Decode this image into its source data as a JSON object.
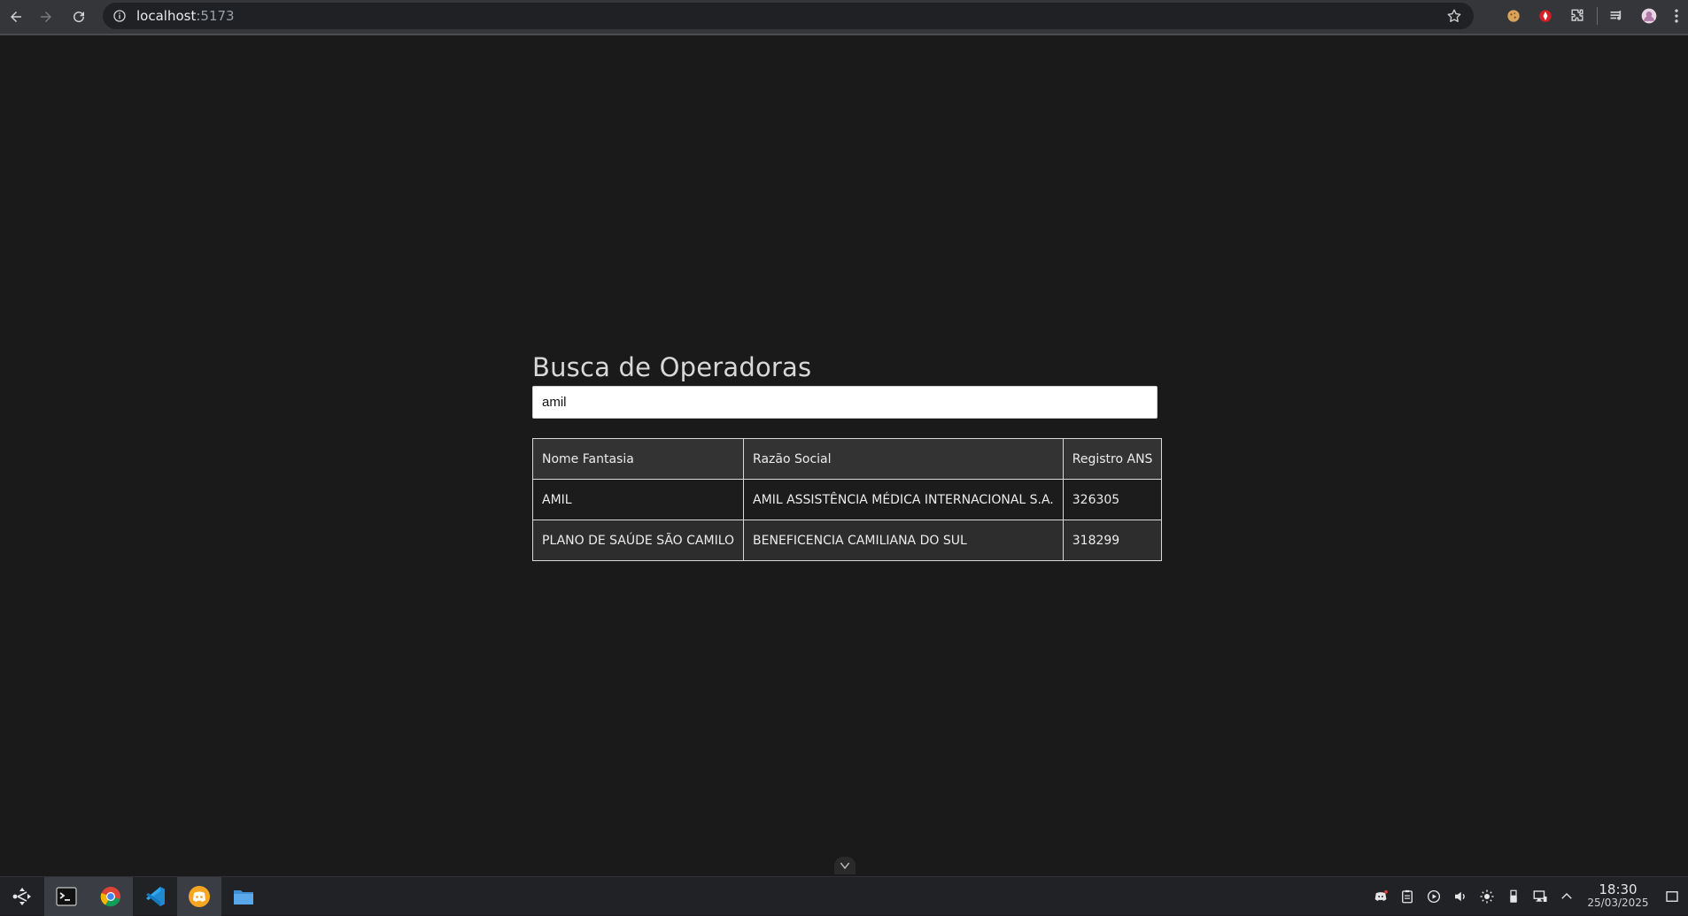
{
  "browser": {
    "url_host": "localhost",
    "url_port": ":5173"
  },
  "page": {
    "title": "Busca de Operadoras",
    "search_value": "amil",
    "table": {
      "headers": [
        "Nome Fantasia",
        "Razão Social",
        "Registro ANS"
      ],
      "rows": [
        [
          "AMIL",
          "AMIL ASSISTÊNCIA MÉDICA INTERNACIONAL S.A.",
          "326305"
        ],
        [
          "PLANO DE SAÚDE SÃO CAMILO",
          "BENEFICENCIA CAMILIANA DO SUL",
          "318299"
        ]
      ]
    }
  },
  "taskbar": {
    "apps": [
      "launcher-icon",
      "terminal-icon",
      "chrome-icon",
      "vscode-icon",
      "discord-icon",
      "files-icon"
    ],
    "tray": [
      "discord-tray-icon",
      "clipboard-icon",
      "media-player-icon",
      "volume-icon",
      "brightness-icon",
      "usb-icon",
      "network-icon",
      "chevron-up-icon"
    ],
    "time": "18:30",
    "date": "25/03/2025"
  },
  "colors": {
    "page_background": "#1a1a1b",
    "browser_bar": "#35363a",
    "taskbar": "#202226",
    "table_header": "#333333",
    "table_border": "#d9d9d9"
  }
}
